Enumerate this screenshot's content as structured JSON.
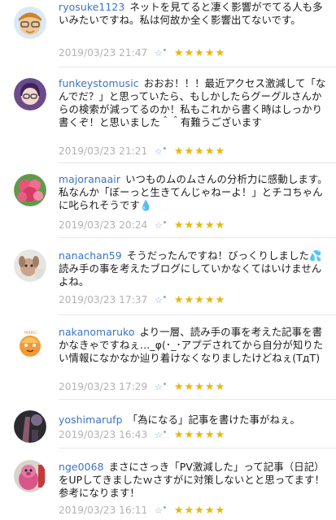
{
  "comments": [
    {
      "user": "ryosuke1123",
      "text": "ネットを見てると凄く影響がでてる人も多いみたいですね。私は何故か全く影響出てないです。",
      "date": "2019/03/23 21:47",
      "stars": "★★★★★"
    },
    {
      "user": "funkeystomusic",
      "text": "おおお！！！最近アクセス激減して「なんでだ？」と思っていたら、もしかしたらグーグルさんからの検索が減ってるのか！私もこれから書く時はしっかり書くぞ！と思いました＾＾有難うございます",
      "date": "2019/03/23 21:21",
      "stars": "★★★★★"
    },
    {
      "user": "majoranaair",
      "text": "いつものムのムさんの分析力に感動します。私なんか「ぼーっと生きてんじゃねーよ！」とチコちゃんに叱られそうです💧",
      "date": "2019/03/23 20:24",
      "stars": "★★★★★"
    },
    {
      "user": "nanachan59",
      "text": "そうだったんですね！びっくりしました💦読み手の事を考えたブログにしていかなくてはいけませんよね。",
      "date": "2019/03/23 17:37",
      "stars": "★★★★★"
    },
    {
      "user": "nakanomaruko",
      "text": "より一層、読み手の事を考えた記事を書かなきゃですねぇ…_φ(･_･アプデされてから自分が知りたい情報になかなか辿り着けなくなりましたけどねぇ(TдT)",
      "date": "2019/03/23 17:29",
      "stars": "★★★★★"
    },
    {
      "user": "yoshimarufp",
      "text": "「為になる」記事を書けた事がねぇ。",
      "date": "2019/03/23 16:43",
      "stars": "★★★★★"
    },
    {
      "user": "nge0068",
      "text": "まさにさっき「PV激減した」って記事（日記）をUPしてきましたｗさすがに対策しないとと思ってます！参考になります！",
      "date": "2019/03/23 16:11",
      "stars": "★★★★★"
    }
  ],
  "icons": {
    "outline_star": "☆"
  }
}
